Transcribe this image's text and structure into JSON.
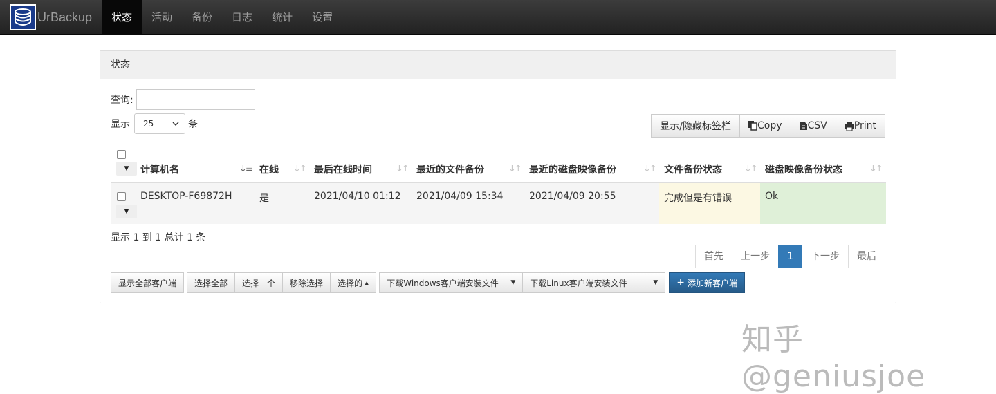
{
  "brand": {
    "name": "UrBackup"
  },
  "nav": [
    {
      "label": "状态"
    },
    {
      "label": "活动"
    },
    {
      "label": "备份"
    },
    {
      "label": "日志"
    },
    {
      "label": "统计"
    },
    {
      "label": "设置"
    }
  ],
  "panel": {
    "title": "状态"
  },
  "search": {
    "label": "查询:",
    "value": ""
  },
  "length": {
    "prefix": "显示",
    "value": "25",
    "suffix": "条"
  },
  "export_buttons": {
    "toggle_columns": "显示/隐藏标签栏",
    "copy": "Copy",
    "csv": "CSV",
    "print": "Print"
  },
  "table": {
    "columns": [
      "计算机名",
      "在线",
      "最后在线时间",
      "最近的文件备份",
      "最近的磁盘映像备份",
      "文件备份状态",
      "磁盘映像备份状态"
    ],
    "rows": [
      {
        "name": "DESKTOP-F69872H",
        "online": "是",
        "last_seen": "2021/04/10 01:12",
        "last_file_backup": "2021/04/09 15:34",
        "last_image_backup": "2021/04/09 20:55",
        "file_status": "完成但是有错误",
        "image_status": "Ok"
      }
    ]
  },
  "info": "显示 1 到 1 总计 1 条",
  "pagination": {
    "first": "首先",
    "prev": "上一步",
    "current": "1",
    "next": "下一步",
    "last": "最后"
  },
  "actions": {
    "show_all": "显示全部客户端",
    "select_all": "选择全部",
    "select_one": "选择一个",
    "remove_selection": "移除选择",
    "selected": "选择的",
    "download_windows": "下载Windows客户端安装文件",
    "download_linux": "下载Linux客户端安装文件",
    "add_client": "添加新客户端"
  },
  "watermark": "知乎 @geniusjoe",
  "colors": {
    "navbar": "#222222",
    "primary": "#337ab7",
    "warning_cell": "#fcf8e3",
    "success_cell": "#dff0d8"
  }
}
